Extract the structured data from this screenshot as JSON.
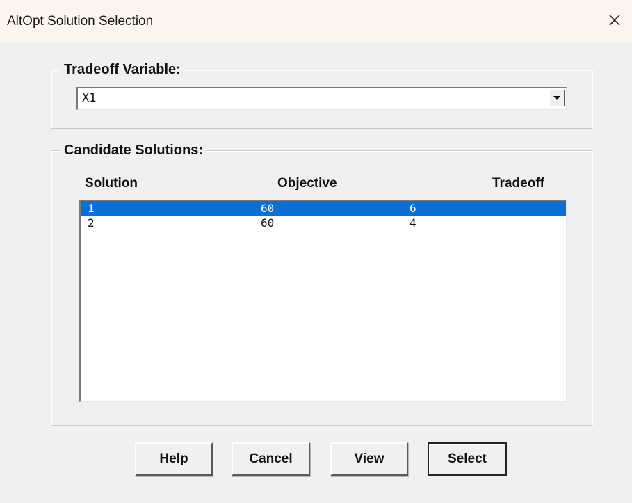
{
  "window": {
    "title": "AltOpt Solution Selection"
  },
  "tradeoff_group": {
    "legend": "Tradeoff Variable:",
    "selected_value": "X1"
  },
  "candidate_group": {
    "legend": "Candidate Solutions:",
    "headers": {
      "solution": "Solution",
      "objective": "Objective",
      "tradeoff": "Tradeoff"
    },
    "rows": [
      {
        "solution": "1",
        "objective": "60",
        "tradeoff": "6",
        "selected": true
      },
      {
        "solution": "2",
        "objective": "60",
        "tradeoff": "4",
        "selected": false
      }
    ]
  },
  "buttons": {
    "help": "Help",
    "cancel": "Cancel",
    "view": "View",
    "select": "Select"
  },
  "colors": {
    "selection": "#0a6fd6",
    "titlebar": "#fbf5ee",
    "dialog_bg": "#f0f0f0"
  },
  "icons": {
    "close": "close-icon",
    "dropdown": "dropdown-arrow-icon"
  }
}
